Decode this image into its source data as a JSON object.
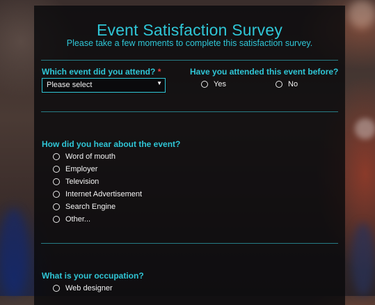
{
  "title": "Event Satisfaction Survey",
  "subtitle": "Please take a few moments to complete this satisfaction survey.",
  "q1": {
    "label": "Which event did you attend?",
    "required_mark": "*",
    "select_value": "Please select"
  },
  "q2": {
    "label": "Have you attended this event before?",
    "options": [
      "Yes",
      "No"
    ]
  },
  "q3": {
    "label": "How did you hear about the event?",
    "options": [
      "Word of mouth",
      "Employer",
      "Television",
      "Internet Advertisement",
      "Search Engine",
      "Other..."
    ]
  },
  "q4": {
    "label": "What is your occupation?",
    "options": [
      "Web designer"
    ]
  },
  "colors": {
    "accent": "#2fc6d6",
    "required": "#e04040",
    "panel": "#0a0a0c"
  },
  "icons": {
    "select_arrow": "chevron-down-icon",
    "radio": "radio-circle-icon"
  }
}
